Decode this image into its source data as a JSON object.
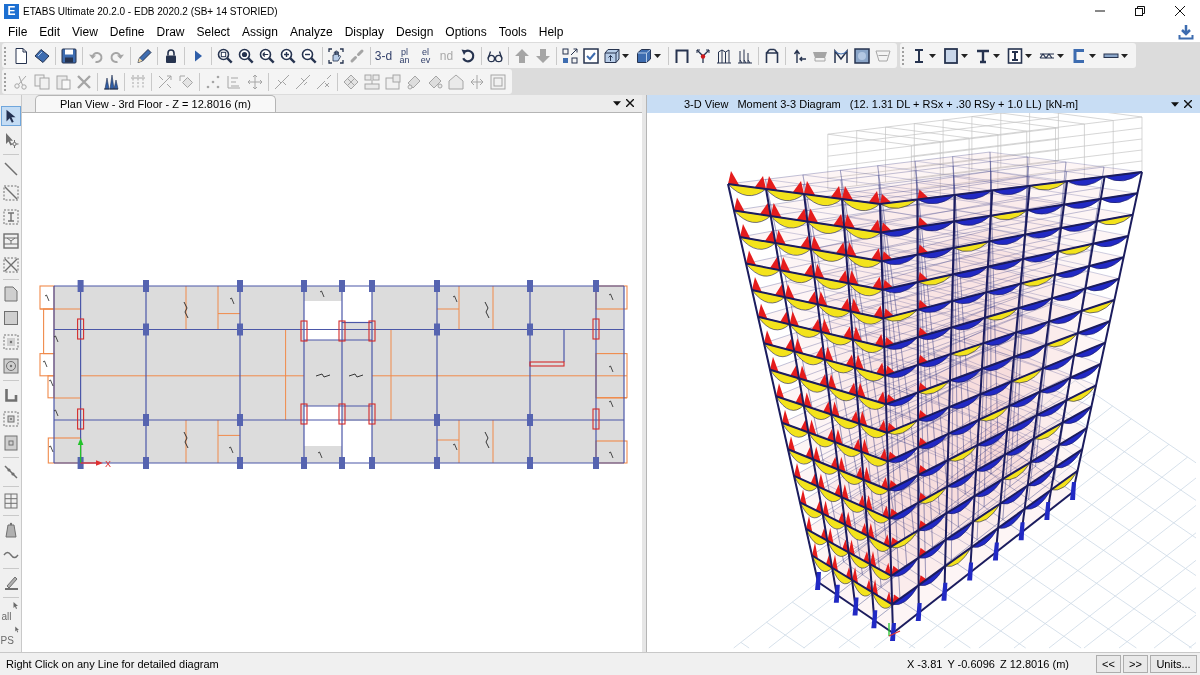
{
  "window": {
    "app_icon": "E",
    "title": "ETABS Ultimate 20.2.0 - EDB 2020.2 (SB+ 14 STORIED)"
  },
  "menu_bar": [
    "File",
    "Edit",
    "View",
    "Define",
    "Draw",
    "Select",
    "Assign",
    "Analyze",
    "Display",
    "Design",
    "Options",
    "Tools",
    "Help"
  ],
  "toolbar_rows": [
    [
      {
        "groups": [
          [
            {
              "kind": "icon",
              "disabled": false
            },
            {
              "kind": "icon",
              "disabled": false
            }
          ],
          [
            {
              "kind": "icon",
              "disabled": false
            }
          ],
          [
            {
              "kind": "icon",
              "disabled": true
            },
            {
              "kind": "icon",
              "disabled": true
            }
          ],
          [
            {
              "kind": "icon",
              "disabled": false
            }
          ],
          [
            {
              "kind": "icon",
              "disabled": false
            }
          ],
          [
            {
              "kind": "icon",
              "disabled": false
            }
          ],
          [
            {
              "kind": "icon",
              "disabled": false
            },
            {
              "kind": "icon",
              "disabled": false
            },
            {
              "kind": "icon",
              "disabled": false
            },
            {
              "kind": "icon",
              "disabled": false
            },
            {
              "kind": "icon",
              "disabled": false
            }
          ],
          [
            {
              "kind": "icon",
              "disabled": false
            },
            {
              "kind": "icon",
              "disabled": true
            }
          ],
          [
            {
              "kind": "text",
              "lines": [
                "3-d"
              ],
              "disabled": false
            },
            {
              "kind": "text",
              "lines": [
                "pl",
                "an"
              ],
              "disabled": false
            },
            {
              "kind": "text",
              "lines": [
                "el",
                "ev"
              ],
              "disabled": false
            },
            {
              "kind": "text",
              "lines": [
                "nd"
              ],
              "disabled": true
            },
            {
              "kind": "icon",
              "disabled": false
            }
          ],
          [
            {
              "kind": "icon",
              "disabled": false
            }
          ],
          [
            {
              "kind": "icon",
              "disabled": true
            },
            {
              "kind": "icon",
              "disabled": true
            }
          ],
          [
            {
              "kind": "icon",
              "disabled": false
            },
            {
              "kind": "icon",
              "disabled": false
            },
            {
              "kind": "dropdown",
              "disabled": false
            },
            {
              "kind": "dropdown",
              "disabled": false
            }
          ],
          [
            {
              "kind": "icon",
              "disabled": false
            },
            {
              "kind": "icon",
              "disabled": false
            },
            {
              "kind": "icon",
              "disabled": false
            },
            {
              "kind": "icon",
              "disabled": false
            }
          ],
          [
            {
              "kind": "icon",
              "disabled": false
            }
          ],
          [
            {
              "kind": "icon",
              "disabled": false
            },
            {
              "kind": "icon",
              "disabled": true
            },
            {
              "kind": "icon",
              "disabled": false
            },
            {
              "kind": "icon",
              "disabled": false
            },
            {
              "kind": "icon",
              "disabled": true
            }
          ]
        ]
      },
      {
        "groups": [
          [
            {
              "kind": "dropdown",
              "disabled": false
            },
            {
              "kind": "dropdown",
              "disabled": false
            },
            {
              "kind": "dropdown",
              "disabled": false
            },
            {
              "kind": "dropdown",
              "disabled": false
            },
            {
              "kind": "dropdown",
              "disabled": false
            },
            {
              "kind": "dropdown",
              "disabled": false
            },
            {
              "kind": "dropdown",
              "disabled": false
            }
          ]
        ]
      }
    ],
    [
      {
        "groups": [
          [
            {
              "kind": "icon",
              "disabled": true
            },
            {
              "kind": "icon",
              "disabled": true
            },
            {
              "kind": "icon",
              "disabled": true
            },
            {
              "kind": "icon",
              "disabled": true
            }
          ],
          [
            {
              "kind": "icon",
              "disabled": false
            }
          ],
          [
            {
              "kind": "icon",
              "disabled": true
            }
          ],
          [
            {
              "kind": "icon",
              "disabled": true
            },
            {
              "kind": "icon",
              "disabled": true
            }
          ],
          [
            {
              "kind": "icon",
              "disabled": true
            },
            {
              "kind": "icon",
              "disabled": true
            },
            {
              "kind": "icon",
              "disabled": true
            }
          ],
          [
            {
              "kind": "icon",
              "disabled": true
            },
            {
              "kind": "icon",
              "disabled": true
            },
            {
              "kind": "icon",
              "disabled": true
            }
          ],
          [
            {
              "kind": "icon",
              "disabled": true
            },
            {
              "kind": "icon",
              "disabled": true
            },
            {
              "kind": "icon",
              "disabled": true
            },
            {
              "kind": "icon",
              "disabled": true
            },
            {
              "kind": "icon",
              "disabled": true
            },
            {
              "kind": "icon",
              "disabled": true
            },
            {
              "kind": "icon",
              "disabled": true
            },
            {
              "kind": "icon",
              "disabled": true
            }
          ]
        ]
      }
    ]
  ],
  "tool_palette": {
    "groups": [
      [
        {
          "kind": "icon",
          "selected": true
        },
        {
          "kind": "icon",
          "selected": false
        }
      ],
      [
        {
          "kind": "icon",
          "selected": false
        },
        {
          "kind": "icon",
          "selected": false
        },
        {
          "kind": "icon",
          "selected": false
        },
        {
          "kind": "icon",
          "selected": false
        },
        {
          "kind": "icon",
          "selected": false
        }
      ],
      [
        {
          "kind": "icon",
          "selected": false
        },
        {
          "kind": "icon",
          "selected": false
        },
        {
          "kind": "icon",
          "selected": false
        },
        {
          "kind": "icon",
          "selected": false
        }
      ],
      [
        {
          "kind": "icon",
          "selected": false
        },
        {
          "kind": "icon",
          "selected": false
        },
        {
          "kind": "icon",
          "selected": false
        }
      ],
      [
        {
          "kind": "icon",
          "selected": false
        }
      ],
      [
        {
          "kind": "icon",
          "selected": false
        }
      ],
      [
        {
          "kind": "icon",
          "selected": false
        },
        {
          "kind": "icon",
          "selected": false
        }
      ],
      [
        {
          "kind": "icon",
          "selected": false
        }
      ],
      [
        {
          "kind": "text",
          "label": "all",
          "selected": false
        },
        {
          "kind": "text",
          "label": "PS",
          "selected": false
        }
      ]
    ]
  },
  "plan_view": {
    "tab_parts": [
      "Plan View - 3rd Floor - Z = 12.8016 (m)"
    ],
    "selected": false,
    "axis_label": "X"
  },
  "model_view": {
    "tab_parts": [
      "3-D View",
      "Moment 3-3 Diagram",
      "(12. 1.31 DL + RSx + .30 RSy + 1.0 LL)",
      "[kN-m]"
    ],
    "selected": true
  },
  "status_bar": {
    "message": "Right Click on any Line for detailed diagram",
    "coordinates": [
      "X -3.81",
      "Y -0.6096",
      "Z 12.8016 (m)"
    ],
    "buttons": [
      "<<",
      ">>",
      "Units..."
    ]
  }
}
